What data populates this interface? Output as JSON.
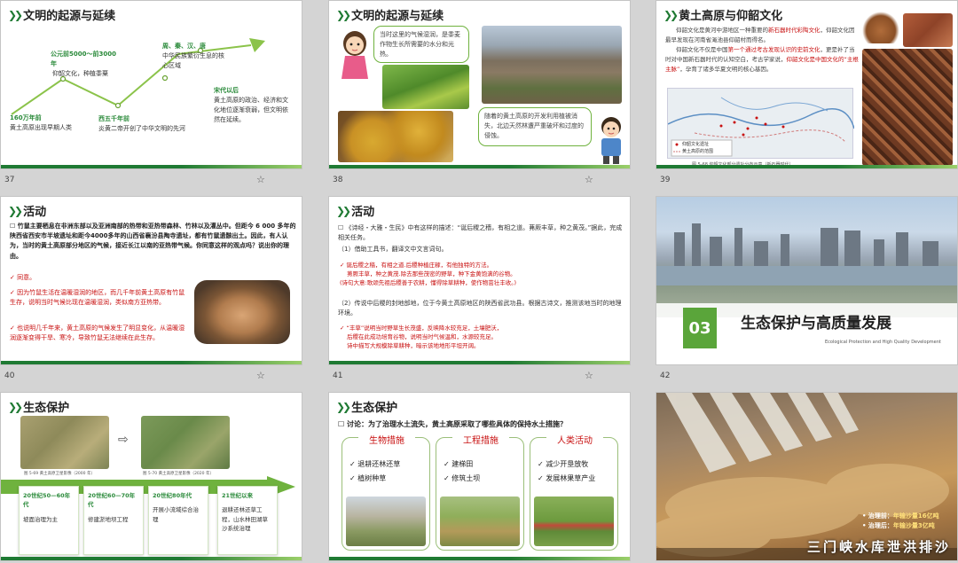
{
  "s37": {
    "num": "37",
    "title": "文明的起源与延续",
    "p1d": "160万年前",
    "p1t": "黄土高原出现早期人类",
    "p2d": "公元前5000～前3000年",
    "p2t": "仰韶文化，种植黍粟",
    "p3d": "西五千年前",
    "p3t": "炎黄二帝开创了中华文明的先河",
    "p4d": "周、秦、汉、唐",
    "p4t": "中华民族繁衍生息的核心区域",
    "p5d": "宋代以后",
    "p5t": "黄土高原的政治、经济和文化地位逐渐衰弱，但文明依然在延续。"
  },
  "s38": {
    "num": "38",
    "title": "文明的起源与延续",
    "b1": "当时这里的气候湿润，是黍麦作物生长所需要的水分和光热。",
    "b2": "随着的黄土高原的开发利用植被消失，北边天然林遭严重破坏和过度的侵蚀。"
  },
  "s39": {
    "num": "39",
    "title": "黄土高原与仰韶文化",
    "p1a": "仰韶文化是黄河中游地区一种重要的",
    "p1b": "新石器时代彩陶文化",
    "p1c": "，仰韶文化因最早发现在河南省渑池县仰韶村而得名。",
    "p2a": "仰韶文化不仅是中国",
    "p2b": "第一个通过考古发现认识的史前文化",
    "p2c": "，更是补了当时对中国新石器时代的认知空白，考古学家说，",
    "p2d": "仰韶文化是中国文化的“主根主脉”",
    "p2e": "，孕育了诸多华夏文明的核心基因。",
    "mapcap": "图 5-68 仰韶文化部分遗址分布示意（新石器时代）",
    "legend1": "仰韶文化遗址",
    "legend2": "黄土高原的范围"
  },
  "s40": {
    "num": "40",
    "title": "活动",
    "q": "竹鼠主要栖息在非洲东部以及亚洲南部的热带和亚热带森林、竹林以及灌丛中。但距今 6 000 多年的陕西省西安市半坡遗址和距今4000多年的山西省襄汾县陶寺遗址，都有竹鼠遗骸出土。因此，有人认为，当时的黄土高原部分地区的气候，接近长江以南的亚热带气候。你同意这样的观点吗？说出你的理由。",
    "a1": "同意。",
    "a2": "因为竹鼠生活在温暖湿润的地区，而几千年前黄土高原有竹鼠生存，说明当时气候比现在温暖湿润，类似南方亚热带。",
    "a3": "也说明几千年来，黄土高原的气候发生了明显变化，从温暖湿润逐渐变得干旱、寒冷，导致竹鼠无法继续在此生存。"
  },
  "s41": {
    "num": "41",
    "title": "活动",
    "i1": "《诗经・大雅・生民》中有这样的描述：“诞后稷之穑，有相之道。茀厥丰草，种之黄茂。”据此，完成相关任务。",
    "i1a": "（1）借助工具书，翻译文中文言词句。",
    "r1a": "诞后稷之穑，有相之道.后稷种植庄稼，有他独特的方法。",
    "r1b": "茀厥丰草，种之黄茂.除去那些茂密的野草，种下金黄饱满的谷物。",
    "r1c": "(诗句大意:歌颂先祖后稷善于农耕，懂得除草耕种，使作物茁壮丰收。)",
    "i2": "（2）传说中后稷的封地邰地，位于今黄土高原地区的陕西省武功县。根据古诗文，推测该地当时的地理环境。",
    "r2a": "“丰草”说明当时野草生长茂盛，反映降水较充足，土壤肥沃，",
    "r2b": "后稷在此成功培育谷物，说明当时气候温和，水源较充足。",
    "r2c": "诗中描写大规模除草耕种，暗示该地地形平坦开阔。"
  },
  "s42": {
    "num": "42",
    "badge": "03",
    "title": "生态保护与高质量发展",
    "sub": "Ecological Protection and High Quality Development"
  },
  "s43": {
    "num": "",
    "title": "生态保护",
    "c1": "图 5-69 黄土高原卫星影像（2000 年）",
    "c2": "图 5-70 黄土高原卫星影像（2020 年）",
    "steps": [
      {
        "d": "20世纪50—60年代",
        "t": "坡面治理为主"
      },
      {
        "d": "20世纪60—70年代",
        "t": "修建淤地坝工程"
      },
      {
        "d": "20世纪80年代",
        "t": "开展小流域综合治理"
      },
      {
        "d": "21世纪以来",
        "t": "退耕还林还草工程，山水林田湖草沙系统治理"
      }
    ]
  },
  "s44": {
    "num": "",
    "title": "生态保护",
    "q": "讨论：为了治理水土流失，黄土高原采取了哪些具体的保持水土措施？",
    "cols": [
      {
        "h": "生物措施",
        "a": "退耕还林还草",
        "b": "植树种草"
      },
      {
        "h": "工程措施",
        "a": "建梯田",
        "b": "修筑土坝"
      },
      {
        "h": "人类活动",
        "a": "减少开垦放牧",
        "b": "发展林果草产业"
      }
    ]
  },
  "s45": {
    "num": "",
    "l1a": "治理前：",
    "l1b": "年输沙量16亿吨",
    "l2a": "治理后：",
    "l2b": "年输沙量3亿吨",
    "cap": "三门峡水库泄洪排沙"
  },
  "colors": {
    "green": "#1f7a33",
    "red": "#c81010",
    "accent": "#8bc34a"
  }
}
